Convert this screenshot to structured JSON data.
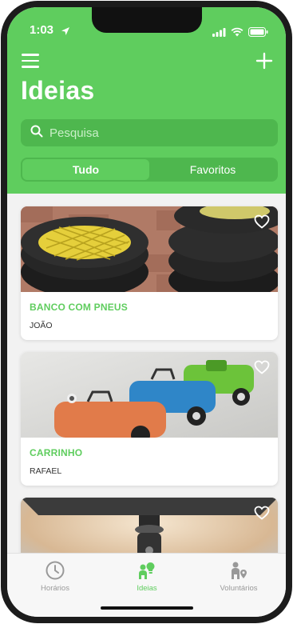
{
  "status_bar": {
    "time": "1:03"
  },
  "header": {
    "title": "Ideias",
    "search_placeholder": "Pesquisa",
    "segments": [
      "Tudo",
      "Favoritos"
    ],
    "active_segment": "Tudo"
  },
  "cards": [
    {
      "title": "BANCO COM PNEUS",
      "author": "JOÃO",
      "image": "tires-bench-photo",
      "favorite": false
    },
    {
      "title": "CARRINHO",
      "author": "RAFAEL",
      "image": "toy-cars-photo",
      "favorite": false
    },
    {
      "title": "",
      "author": "",
      "image": "bottle-lamp-photo",
      "favorite": false
    }
  ],
  "tabbar": {
    "tabs": [
      {
        "label": "Horários",
        "icon": "clock-icon"
      },
      {
        "label": "Ideias",
        "icon": "people-ideas-icon"
      },
      {
        "label": "Voluntários",
        "icon": "volunteer-location-icon"
      }
    ],
    "active_tab": "Ideias"
  },
  "colors": {
    "accent": "#5fcd5e",
    "accent_dark": "#4eb74e",
    "background": "#f2f2f2"
  }
}
